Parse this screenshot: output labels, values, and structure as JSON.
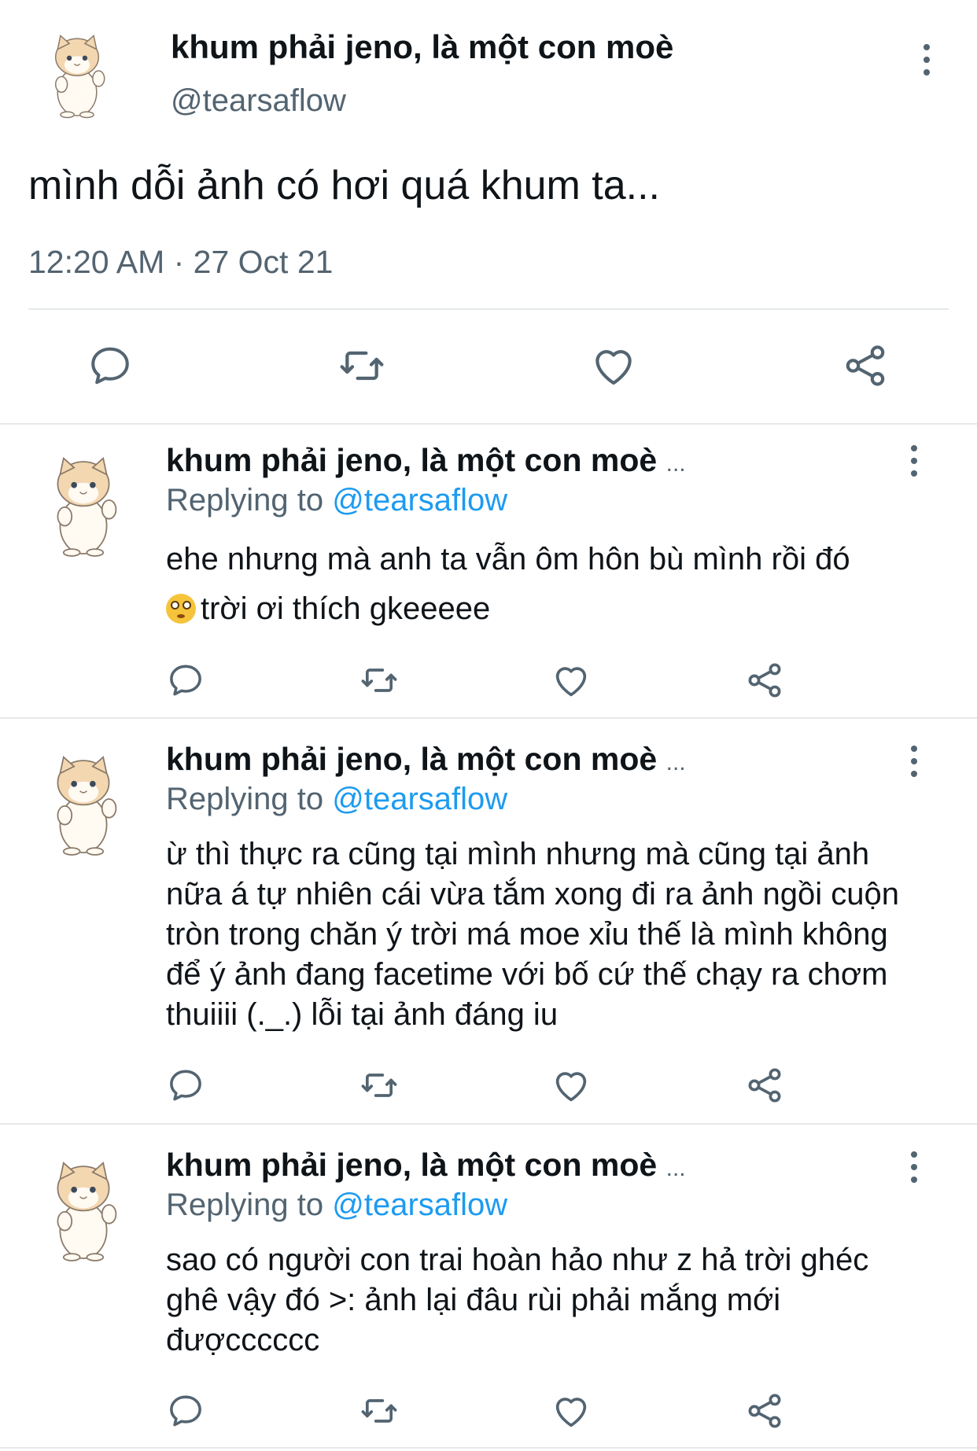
{
  "main_tweet": {
    "display_name": "khum phải jeno, là một con moè",
    "handle": "@tearsaflow",
    "text": "mình dỗi ảnh có hơi quá khum ta...",
    "timestamp": "12:20 AM · 27 Oct 21",
    "more_icon": "more-vertical-icon"
  },
  "replies": [
    {
      "display_name": "khum phải jeno, là một con moè",
      "truncation": "...",
      "replying_label": "Replying to",
      "replying_handle": "@tearsaflow",
      "text_line1": "ehe nhưng mà anh ta vẫn ôm hôn bù mình rồi đó",
      "emoji": "flushed-face-emoji",
      "text_line2": "trời ơi thích gkeeeee"
    },
    {
      "display_name": "khum phải jeno, là một con moè",
      "truncation": "...",
      "replying_label": "Replying to",
      "replying_handle": "@tearsaflow",
      "text": "ừ thì thực ra cũng tại mình nhưng mà cũng tại ảnh nữa á tự nhiên cái vừa tắm xong đi ra ảnh ngồi cuộn tròn trong chăn ý trời má moe xỉu thế là mình không để ý ảnh đang facetime với bố cứ thế chạy ra chơm thuiiii (._.) lỗi tại ảnh đáng iu"
    },
    {
      "display_name": "khum phải jeno, là một con moè",
      "truncation": "...",
      "replying_label": "Replying to",
      "replying_handle": "@tearsaflow",
      "text": "sao có người con trai hoàn hảo như z hả trời ghéc ghê vậy đó >: ảnh lại đâu rùi phải mắng mới đượcccccc"
    }
  ],
  "actions": {
    "reply_icon": "reply-icon",
    "retweet_icon": "retweet-icon",
    "like_icon": "heart-icon",
    "share_icon": "share-icon"
  },
  "colors": {
    "text": "#0f1419",
    "secondary": "#536471",
    "mention": "#1d9bf0",
    "divider": "#e6e9eb"
  }
}
